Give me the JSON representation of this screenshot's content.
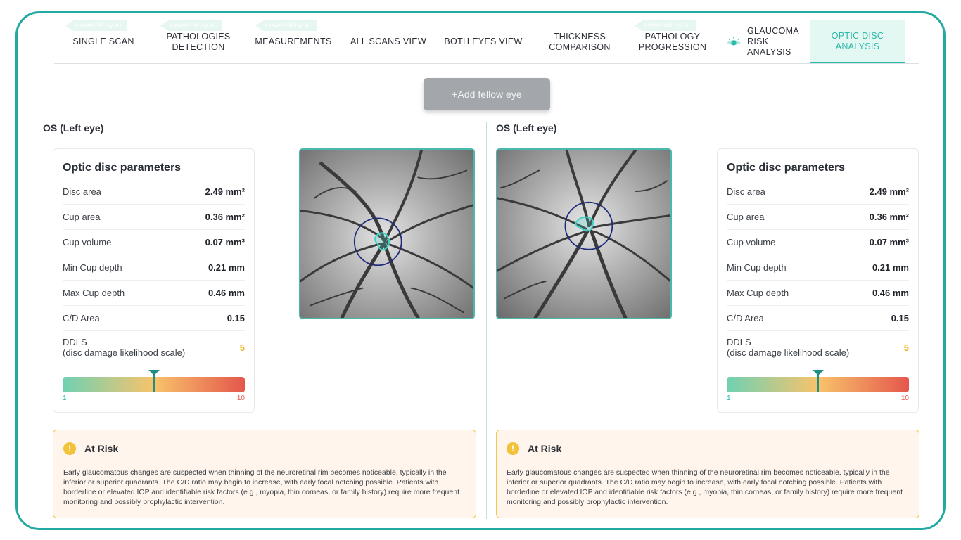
{
  "tabs": [
    {
      "label": "SINGLE SCAN",
      "badge": "Powered By AI",
      "active": false
    },
    {
      "label": "PATHOLOGIES DETECTION",
      "badge": "Powered By AI",
      "active": false
    },
    {
      "label": "MEASUREMENTS",
      "badge": "Powered By AI",
      "active": false
    },
    {
      "label": "ALL SCANS VIEW",
      "badge": "",
      "active": false
    },
    {
      "label": "BOTH EYES VIEW",
      "badge": "",
      "active": false
    },
    {
      "label": "THICKNESS COMPARISON",
      "badge": "",
      "active": false
    },
    {
      "label": "PATHOLOGY PROGRESSION",
      "badge": "Powered By AI",
      "active": false
    },
    {
      "label": "GLAUCOMA RISK ANALYSIS",
      "badge": "",
      "icon": "eye-icon",
      "active": false
    },
    {
      "label": "OPTIC DISC ANALYSIS",
      "badge": "",
      "active": true
    }
  ],
  "add_fellow_label": "+Add fellow eye",
  "colors": {
    "accent": "#2cb9a8",
    "frame": "#22a9a0",
    "warning": "#f2c23a",
    "scale_low": "#6fd1b2",
    "scale_mid": "#f8c36c",
    "scale_high": "#e4574c",
    "disc_outline": "#1e2a7a",
    "cup_outline": "#3fd1c4"
  },
  "eyes": [
    {
      "title": "OS (Left eye)",
      "card": {
        "title": "Optic disc parameters",
        "params": [
          {
            "label": "Disc area",
            "value": "2.49 mm²"
          },
          {
            "label": "Cup area",
            "value": "0.36 mm²"
          },
          {
            "label": "Cup volume",
            "value": "0.07 mm³"
          },
          {
            "label": "Min Cup depth",
            "value": "0.21 mm"
          },
          {
            "label": "Max Cup depth",
            "value": "0.46 mm"
          },
          {
            "label": "C/D Area",
            "value": "0.15"
          }
        ],
        "ddls_label": "DDLS",
        "ddls_sub": "(disc damage likelihood scale)",
        "ddls_value": "5",
        "scale_min": "1",
        "scale_max": "10",
        "scale_position": 0.5
      },
      "risk": {
        "title": "At Risk",
        "icon": "warning-icon",
        "text": "Early glaucomatous changes are suspected when thinning of the neuroretinal rim becomes noticeable, typically in the inferior or superior quadrants. The C/D ratio may begin to increase, with early focal notching possible. Patients with borderline or elevated IOP and identifiable risk factors (e.g., myopia, thin corneas, or family history) require more frequent monitoring and possibly prophylactic intervention."
      }
    },
    {
      "title": "OS (Left eye)",
      "card": {
        "title": "Optic disc parameters",
        "params": [
          {
            "label": "Disc area",
            "value": "2.49 mm²"
          },
          {
            "label": "Cup area",
            "value": "0.36 mm²"
          },
          {
            "label": "Cup volume",
            "value": "0.07 mm³"
          },
          {
            "label": "Min Cup depth",
            "value": "0.21 mm"
          },
          {
            "label": "Max Cup depth",
            "value": "0.46 mm"
          },
          {
            "label": "C/D Area",
            "value": "0.15"
          }
        ],
        "ddls_label": "DDLS",
        "ddls_sub": "(disc damage likelihood scale)",
        "ddls_value": "5",
        "scale_min": "1",
        "scale_max": "10",
        "scale_position": 0.5
      },
      "risk": {
        "title": "At Risk",
        "icon": "warning-icon",
        "text": "Early glaucomatous changes are suspected when thinning of the neuroretinal rim becomes noticeable, typically in the inferior or superior quadrants. The C/D ratio may begin to increase, with early focal notching possible. Patients with borderline or elevated IOP and identifiable risk factors (e.g., myopia, thin corneas, or family history) require more frequent monitoring and possibly prophylactic intervention."
      }
    }
  ]
}
